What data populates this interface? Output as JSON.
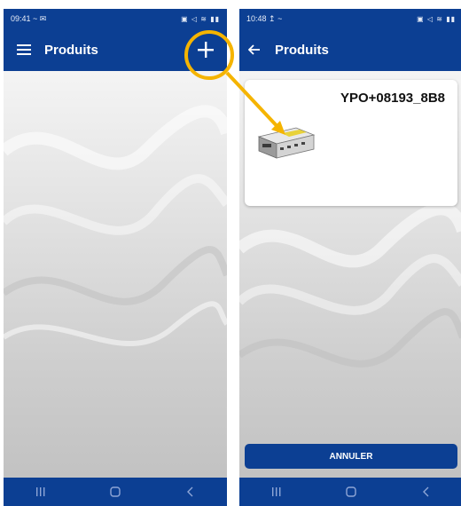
{
  "left_screen": {
    "status_time": "09:41",
    "status_left_icons": "~ ✉",
    "status_right_icons": "▣ ◁ ≋ ▮▮",
    "title": "Produits",
    "menu_icon": "hamburger-menu-icon",
    "add_icon": "plus-icon"
  },
  "right_screen": {
    "status_time": "10:48",
    "status_left_icons": "↥ ~",
    "status_right_icons": "▣ ◁ ≋ ▮▮",
    "title": "Produits",
    "back_icon": "arrow-left-icon",
    "product_card": {
      "code": "YPO+08193_8B8",
      "image_icon": "controller-device-icon"
    },
    "cancel_label": "ANNULER"
  },
  "nav": {
    "recent_icon": "recent-apps-icon",
    "home_icon": "home-icon",
    "back_icon": "back-chevron-icon"
  },
  "colors": {
    "app_bar": "#0c3f93",
    "highlight": "#f5b400",
    "cancel_button": "#0c3f93"
  }
}
